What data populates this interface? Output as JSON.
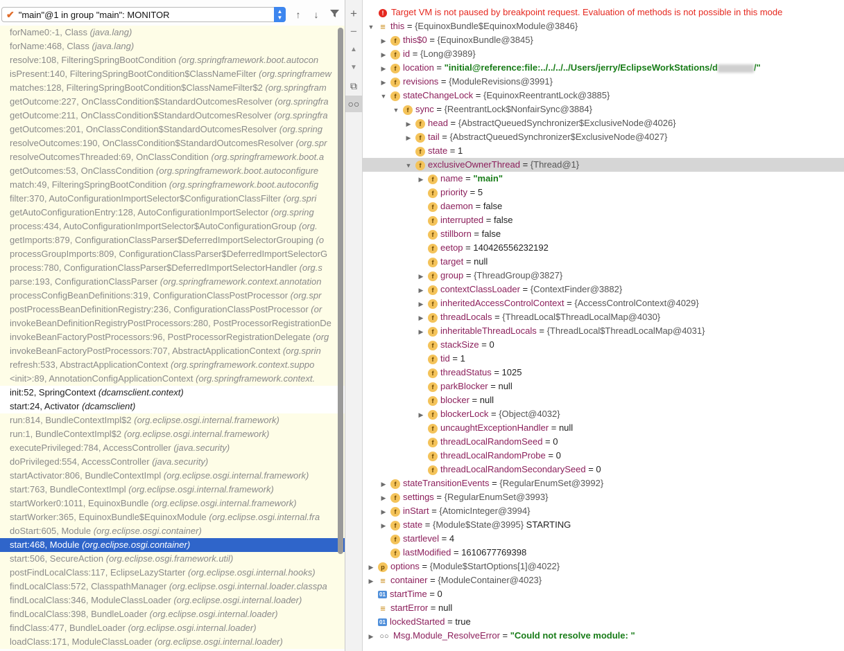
{
  "thread_selector": {
    "label": "\"main\"@1 in group \"main\": MONITOR"
  },
  "toolbar": {
    "up": "↑",
    "down": "↓",
    "filter": "filter"
  },
  "frames": [
    {
      "m": "forName0:-1, Class",
      "p": "(java.lang)",
      "s": "lib"
    },
    {
      "m": "forName:468, Class",
      "p": "(java.lang)",
      "s": "lib"
    },
    {
      "m": "resolve:108, FilteringSpringBootCondition",
      "p": "(org.springframework.boot.autocon",
      "s": "lib"
    },
    {
      "m": "isPresent:140, FilteringSpringBootCondition$ClassNameFilter",
      "p": "(org.springframew",
      "s": "lib"
    },
    {
      "m": "matches:128, FilteringSpringBootCondition$ClassNameFilter$2",
      "p": "(org.springfram",
      "s": "lib"
    },
    {
      "m": "getOutcome:227, OnClassCondition$StandardOutcomesResolver",
      "p": "(org.springfra",
      "s": "lib"
    },
    {
      "m": "getOutcome:211, OnClassCondition$StandardOutcomesResolver",
      "p": "(org.springfra",
      "s": "lib"
    },
    {
      "m": "getOutcomes:201, OnClassCondition$StandardOutcomesResolver",
      "p": "(org.spring",
      "s": "lib"
    },
    {
      "m": "resolveOutcomes:190, OnClassCondition$StandardOutcomesResolver",
      "p": "(org.spr",
      "s": "lib"
    },
    {
      "m": "resolveOutcomesThreaded:69, OnClassCondition",
      "p": "(org.springframework.boot.a",
      "s": "lib"
    },
    {
      "m": "getOutcomes:53, OnClassCondition",
      "p": "(org.springframework.boot.autoconfigure",
      "s": "lib"
    },
    {
      "m": "match:49, FilteringSpringBootCondition",
      "p": "(org.springframework.boot.autoconfig",
      "s": "lib"
    },
    {
      "m": "filter:370, AutoConfigurationImportSelector$ConfigurationClassFilter",
      "p": "(org.spri",
      "s": "lib"
    },
    {
      "m": "getAutoConfigurationEntry:128, AutoConfigurationImportSelector",
      "p": "(org.spring",
      "s": "lib"
    },
    {
      "m": "process:434, AutoConfigurationImportSelector$AutoConfigurationGroup",
      "p": "(org.",
      "s": "lib"
    },
    {
      "m": "getImports:879, ConfigurationClassParser$DeferredImportSelectorGrouping",
      "p": "(o",
      "s": "lib"
    },
    {
      "m": "processGroupImports:809, ConfigurationClassParser$DeferredImportSelectorG",
      "p": "",
      "s": "lib"
    },
    {
      "m": "process:780, ConfigurationClassParser$DeferredImportSelectorHandler",
      "p": "(org.s",
      "s": "lib"
    },
    {
      "m": "parse:193, ConfigurationClassParser",
      "p": "(org.springframework.context.annotation",
      "s": "lib"
    },
    {
      "m": "processConfigBeanDefinitions:319, ConfigurationClassPostProcessor",
      "p": "(org.spr",
      "s": "lib"
    },
    {
      "m": "postProcessBeanDefinitionRegistry:236, ConfigurationClassPostProcessor",
      "p": "(or",
      "s": "lib"
    },
    {
      "m": "invokeBeanDefinitionRegistryPostProcessors:280, PostProcessorRegistrationDe",
      "p": "",
      "s": "lib"
    },
    {
      "m": "invokeBeanFactoryPostProcessors:96, PostProcessorRegistrationDelegate",
      "p": "(org",
      "s": "lib"
    },
    {
      "m": "invokeBeanFactoryPostProcessors:707, AbstractApplicationContext",
      "p": "(org.sprin",
      "s": "lib"
    },
    {
      "m": "refresh:533, AbstractApplicationContext",
      "p": "(org.springframework.context.suppo",
      "s": "lib"
    },
    {
      "m": "<init>:89, AnnotationConfigApplicationContext",
      "p": "(org.springframework.context.",
      "s": "lib"
    },
    {
      "m": "init:52, SpringContext",
      "p": "(dcamsclient.context)",
      "s": "plain"
    },
    {
      "m": "start:24, Activator",
      "p": "(dcamsclient)",
      "s": "plain"
    },
    {
      "m": "run:814, BundleContextImpl$2",
      "p": "(org.eclipse.osgi.internal.framework)",
      "s": "lib"
    },
    {
      "m": "run:1, BundleContextImpl$2",
      "p": "(org.eclipse.osgi.internal.framework)",
      "s": "lib"
    },
    {
      "m": "executePrivileged:784, AccessController",
      "p": "(java.security)",
      "s": "lib"
    },
    {
      "m": "doPrivileged:554, AccessController",
      "p": "(java.security)",
      "s": "lib"
    },
    {
      "m": "startActivator:806, BundleContextImpl",
      "p": "(org.eclipse.osgi.internal.framework)",
      "s": "lib"
    },
    {
      "m": "start:763, BundleContextImpl",
      "p": "(org.eclipse.osgi.internal.framework)",
      "s": "lib"
    },
    {
      "m": "startWorker0:1011, EquinoxBundle",
      "p": "(org.eclipse.osgi.internal.framework)",
      "s": "lib"
    },
    {
      "m": "startWorker:365, EquinoxBundle$EquinoxModule",
      "p": "(org.eclipse.osgi.internal.fra",
      "s": "lib"
    },
    {
      "m": "doStart:605, Module",
      "p": "(org.eclipse.osgi.container)",
      "s": "lib"
    },
    {
      "m": "start:468, Module",
      "p": "(org.eclipse.osgi.container)",
      "s": "selected"
    },
    {
      "m": "start:506, SecureAction",
      "p": "(org.eclipse.osgi.framework.util)",
      "s": "lib"
    },
    {
      "m": "postFindLocalClass:117, EclipseLazyStarter",
      "p": "(org.eclipse.osgi.internal.hooks)",
      "s": "lib"
    },
    {
      "m": "findLocalClass:572, ClasspathManager",
      "p": "(org.eclipse.osgi.internal.loader.classpa",
      "s": "lib"
    },
    {
      "m": "findLocalClass:346, ModuleClassLoader",
      "p": "(org.eclipse.osgi.internal.loader)",
      "s": "lib"
    },
    {
      "m": "findLocalClass:398, BundleLoader",
      "p": "(org.eclipse.osgi.internal.loader)",
      "s": "lib"
    },
    {
      "m": "findClass:477, BundleLoader",
      "p": "(org.eclipse.osgi.internal.loader)",
      "s": "lib"
    },
    {
      "m": "loadClass:171, ModuleClassLoader",
      "p": "(org.eclipse.osgi.internal.loader)",
      "s": "lib"
    }
  ],
  "variables": {
    "error": "Target VM is not paused by breakpoint request. Evaluation of methods is not possible in this mode",
    "rows": [
      {
        "d": 0,
        "t": "open",
        "i": "lines",
        "n": "this",
        "v": "{EquinoxBundle$EquinoxModule@3846}"
      },
      {
        "d": 1,
        "t": "closed",
        "i": "f",
        "n": "this$0",
        "v": "{EquinoxBundle@3845}"
      },
      {
        "d": 1,
        "t": "closed",
        "i": "f",
        "n": "id",
        "v": "{Long@3989}"
      },
      {
        "d": 1,
        "t": "closed",
        "i": "f",
        "n": "location",
        "s": "\"initial@reference:file:../../../../Users/jerry/EclipseWorkStations/d",
        "s2": "/\"",
        "blur": true
      },
      {
        "d": 1,
        "t": "closed",
        "i": "f",
        "n": "revisions",
        "v": "{ModuleRevisions@3991}"
      },
      {
        "d": 1,
        "t": "open",
        "i": "f",
        "n": "stateChangeLock",
        "v": "{EquinoxReentrantLock@3885}"
      },
      {
        "d": 2,
        "t": "open",
        "i": "f",
        "n": "sync",
        "v": "{ReentrantLock$NonfairSync@3884}"
      },
      {
        "d": 3,
        "t": "closed",
        "i": "f",
        "n": "head",
        "v": "{AbstractQueuedSynchronizer$ExclusiveNode@4026}"
      },
      {
        "d": 3,
        "t": "closed",
        "i": "f",
        "n": "tail",
        "v": "{AbstractQueuedSynchronizer$ExclusiveNode@4027}"
      },
      {
        "d": 3,
        "t": "none",
        "i": "f",
        "n": "state",
        "pv": "1"
      },
      {
        "d": 3,
        "t": "open",
        "i": "f",
        "n": "exclusiveOwnerThread",
        "v": "{Thread@1}",
        "hl": true
      },
      {
        "d": 4,
        "t": "closed",
        "i": "f",
        "n": "name",
        "s": "\"main\""
      },
      {
        "d": 4,
        "t": "none",
        "i": "f",
        "n": "priority",
        "pv": "5"
      },
      {
        "d": 4,
        "t": "none",
        "i": "f",
        "n": "daemon",
        "pv": "false"
      },
      {
        "d": 4,
        "t": "none",
        "i": "f",
        "n": "interrupted",
        "pv": "false"
      },
      {
        "d": 4,
        "t": "none",
        "i": "f",
        "n": "stillborn",
        "pv": "false"
      },
      {
        "d": 4,
        "t": "none",
        "i": "f",
        "n": "eetop",
        "pv": "140426556232192"
      },
      {
        "d": 4,
        "t": "none",
        "i": "f",
        "n": "target",
        "pv": "null"
      },
      {
        "d": 4,
        "t": "closed",
        "i": "f",
        "n": "group",
        "v": "{ThreadGroup@3827}"
      },
      {
        "d": 4,
        "t": "closed",
        "i": "f",
        "n": "contextClassLoader",
        "v": "{ContextFinder@3882}"
      },
      {
        "d": 4,
        "t": "closed",
        "i": "f",
        "n": "inheritedAccessControlContext",
        "v": "{AccessControlContext@4029}"
      },
      {
        "d": 4,
        "t": "closed",
        "i": "f",
        "n": "threadLocals",
        "v": "{ThreadLocal$ThreadLocalMap@4030}"
      },
      {
        "d": 4,
        "t": "closed",
        "i": "f",
        "n": "inheritableThreadLocals",
        "v": "{ThreadLocal$ThreadLocalMap@4031}"
      },
      {
        "d": 4,
        "t": "none",
        "i": "f",
        "n": "stackSize",
        "pv": "0"
      },
      {
        "d": 4,
        "t": "none",
        "i": "f",
        "n": "tid",
        "pv": "1"
      },
      {
        "d": 4,
        "t": "none",
        "i": "f",
        "n": "threadStatus",
        "pv": "1025"
      },
      {
        "d": 4,
        "t": "none",
        "i": "f",
        "n": "parkBlocker",
        "pv": "null"
      },
      {
        "d": 4,
        "t": "none",
        "i": "f",
        "n": "blocker",
        "pv": "null"
      },
      {
        "d": 4,
        "t": "closed",
        "i": "f",
        "n": "blockerLock",
        "v": "{Object@4032}"
      },
      {
        "d": 4,
        "t": "none",
        "i": "f",
        "n": "uncaughtExceptionHandler",
        "pv": "null"
      },
      {
        "d": 4,
        "t": "none",
        "i": "f",
        "n": "threadLocalRandomSeed",
        "pv": "0"
      },
      {
        "d": 4,
        "t": "none",
        "i": "f",
        "n": "threadLocalRandomProbe",
        "pv": "0"
      },
      {
        "d": 4,
        "t": "none",
        "i": "f",
        "n": "threadLocalRandomSecondarySeed",
        "pv": "0"
      },
      {
        "d": 1,
        "t": "closed",
        "i": "f",
        "n": "stateTransitionEvents",
        "v": "{RegularEnumSet@3992}"
      },
      {
        "d": 1,
        "t": "closed",
        "i": "f",
        "n": "settings",
        "v": "{RegularEnumSet@3993}"
      },
      {
        "d": 1,
        "t": "closed",
        "i": "f",
        "n": "inStart",
        "v": "{AtomicInteger@3994}"
      },
      {
        "d": 1,
        "t": "closed",
        "i": "f",
        "n": "state",
        "v": "{Module$State@3995}",
        "pv": "STARTING"
      },
      {
        "d": 1,
        "t": "none",
        "i": "f",
        "n": "startlevel",
        "pv": "4"
      },
      {
        "d": 1,
        "t": "none",
        "i": "f",
        "n": "lastModified",
        "pv": "1610677769398"
      },
      {
        "d": 0,
        "t": "closed",
        "i": "p",
        "n": "options",
        "v": "{Module$StartOptions[1]@4022}"
      },
      {
        "d": 0,
        "t": "closed",
        "i": "lines",
        "n": "container",
        "v": "{ModuleContainer@4023}"
      },
      {
        "d": 0,
        "t": "none",
        "i": "b01",
        "n": "startTime",
        "pv": "0"
      },
      {
        "d": 0,
        "t": "none",
        "i": "lines",
        "n": "startError",
        "pv": "null"
      },
      {
        "d": 0,
        "t": "none",
        "i": "b01",
        "n": "lockedStarted",
        "pv": "true"
      },
      {
        "d": 0,
        "t": "closed",
        "i": "glasses",
        "n": "Msg.Module_ResolveError",
        "s": "\"Could not resolve module: \""
      }
    ]
  }
}
